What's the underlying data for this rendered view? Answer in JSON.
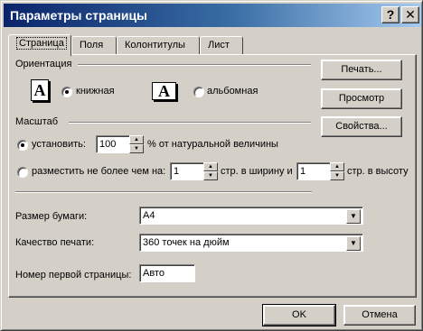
{
  "window": {
    "title": "Параметры страницы",
    "help_label": "?",
    "close_label": "✕"
  },
  "tabs": [
    {
      "label": "Страница",
      "active": true
    },
    {
      "label": "Поля"
    },
    {
      "label": "Колонтитулы"
    },
    {
      "label": "Лист"
    }
  ],
  "orientation": {
    "heading": "Ориентация",
    "icon_glyph": "A",
    "portrait_label": "книжная",
    "landscape_label": "альбомная",
    "selected": "portrait"
  },
  "scale": {
    "heading": "Масштаб",
    "set_label": "установить:",
    "set_value": "100",
    "set_suffix": "% от натуральной величины",
    "fit_label": "разместить не более чем на:",
    "fit_wide_value": "1",
    "fit_wide_suffix": "стр. в ширину и",
    "fit_tall_value": "1",
    "fit_tall_suffix": "стр. в высоту",
    "selected": "set"
  },
  "paper_size": {
    "label": "Размер бумаги:",
    "value": "A4"
  },
  "print_quality": {
    "label": "Качество печати:",
    "value": "360 точек на дюйм"
  },
  "first_page": {
    "label": "Номер первой страницы:",
    "value": "Авто"
  },
  "side_buttons": {
    "print": "Печать...",
    "preview": "Просмотр",
    "properties": "Свойства..."
  },
  "footer": {
    "ok": "OK",
    "cancel": "Отмена"
  },
  "icons": {
    "spin_up": "▲",
    "spin_down": "▼",
    "dropdown": "▼"
  }
}
